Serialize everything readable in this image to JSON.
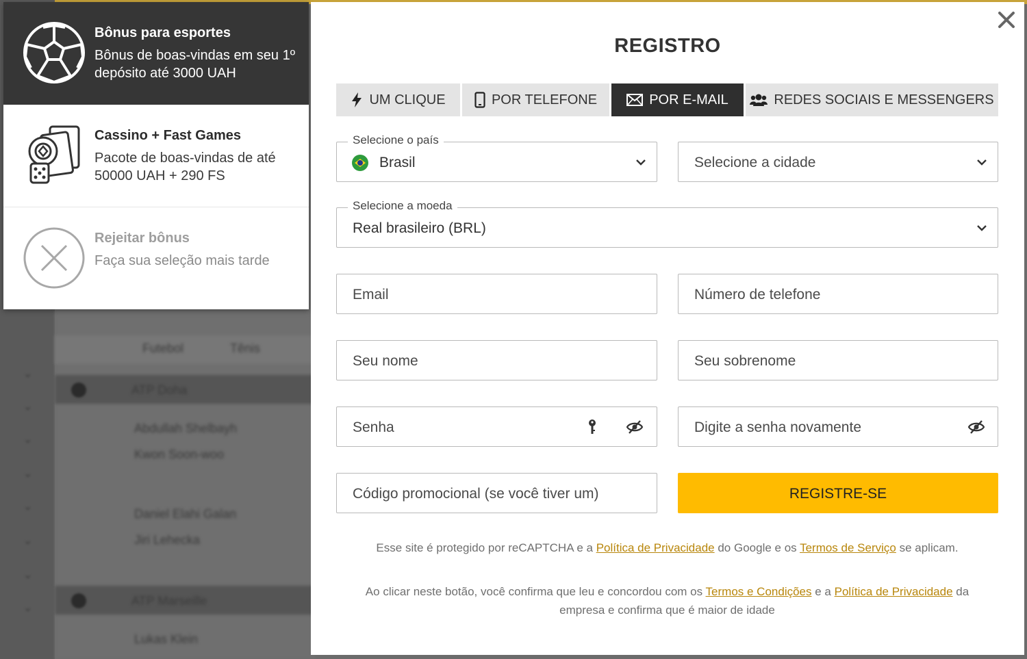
{
  "background_site": {
    "rows": [
      {
        "text": "Futebol"
      },
      {
        "text": "Tênis"
      },
      {
        "text": "ATP Doha"
      },
      {
        "text": "Abdullah Shelbayh"
      },
      {
        "text": "Kwon Soon-woo"
      },
      {
        "text": "Daniel Elahi Galan"
      },
      {
        "text": "Jiri Lehecka"
      },
      {
        "text": "ATP Marseille"
      },
      {
        "text": "Lukas Klein"
      }
    ]
  },
  "bonus_panel": {
    "items": [
      {
        "title": "Bônus para esportes",
        "desc": "Bônus de boas-vindas em seu 1º depósito até 3000 UAH",
        "icon": "soccer-ball-icon"
      },
      {
        "title": "Cassino + Fast Games",
        "desc": "Pacote de boas-vindas de até 50000 UAH + 290 FS",
        "icon": "casino-cards-icon"
      },
      {
        "title": "Rejeitar bônus",
        "desc": "Faça sua seleção mais tarde",
        "icon": "reject-x-icon"
      }
    ]
  },
  "modal": {
    "title": "REGISTRO",
    "close_icon": "close-icon",
    "tabs": [
      {
        "label": "UM CLIQUE",
        "icon": "lightning-icon",
        "active": false
      },
      {
        "label": "POR TELEFONE",
        "icon": "phone-icon",
        "active": false
      },
      {
        "label": "POR E-MAIL",
        "icon": "envelope-icon",
        "active": true
      },
      {
        "label": "REDES SOCIAIS E MESSENGERS",
        "icon": "users-icon",
        "active": false
      }
    ],
    "country": {
      "legend": "Selecione o país",
      "value": "Brasil"
    },
    "city": {
      "placeholder": "Selecione a cidade"
    },
    "currency": {
      "legend": "Selecione a moeda",
      "value": "Real brasileiro (BRL)"
    },
    "email": {
      "placeholder": "Email"
    },
    "phone": {
      "placeholder": "Número de telefone"
    },
    "first_name": {
      "placeholder": "Seu nome"
    },
    "last_name": {
      "placeholder": "Seu sobrenome"
    },
    "password": {
      "placeholder": "Senha"
    },
    "password_repeat": {
      "placeholder": "Digite a senha novamente"
    },
    "promo": {
      "placeholder": "Código promocional (se você tiver um)"
    },
    "register_button": "REGISTRE-SE",
    "recaptcha": {
      "prefix": "Esse site é protegido por reCAPTCHA e a ",
      "privacy_link": "Política de Privacidade",
      "middle": " do Google e os ",
      "terms_link": "Termos de Serviço",
      "suffix": " se aplicam."
    },
    "consent": {
      "prefix": "Ao clicar neste botão, você confirma que leu e concordou com os ",
      "terms_link": "Termos e Condições",
      "middle": " e a ",
      "privacy_link": "Política de Privacidade",
      "suffix": " da empresa e confirma que é maior de idade"
    },
    "colors": {
      "accent": "#ffbb00",
      "active_tab": "#2f2f2f",
      "link": "#b8860b"
    }
  }
}
